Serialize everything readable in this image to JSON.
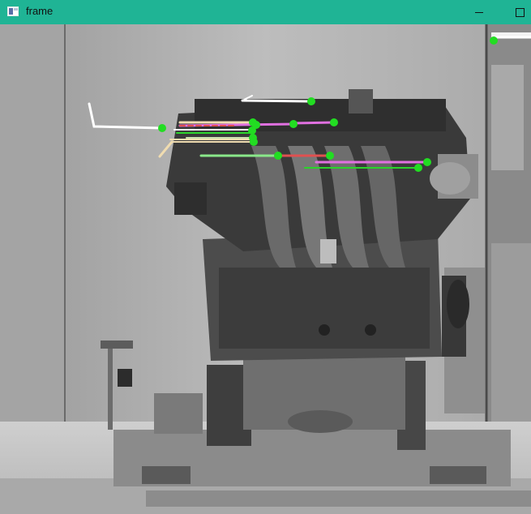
{
  "window": {
    "title": "frame",
    "icon": "window-app-icon",
    "controls": [
      "minimize-icon",
      "maximize-icon"
    ],
    "accent_color": "#1fb495"
  },
  "frame_overlay": {
    "description_colors": {
      "keypoint": "#22dd22",
      "track_white": "#ffffff",
      "track_magenta": "#e070e0",
      "track_green": "#2bd42b",
      "track_red": "#e05050",
      "track_cream": "#f0dcb0"
    }
  }
}
